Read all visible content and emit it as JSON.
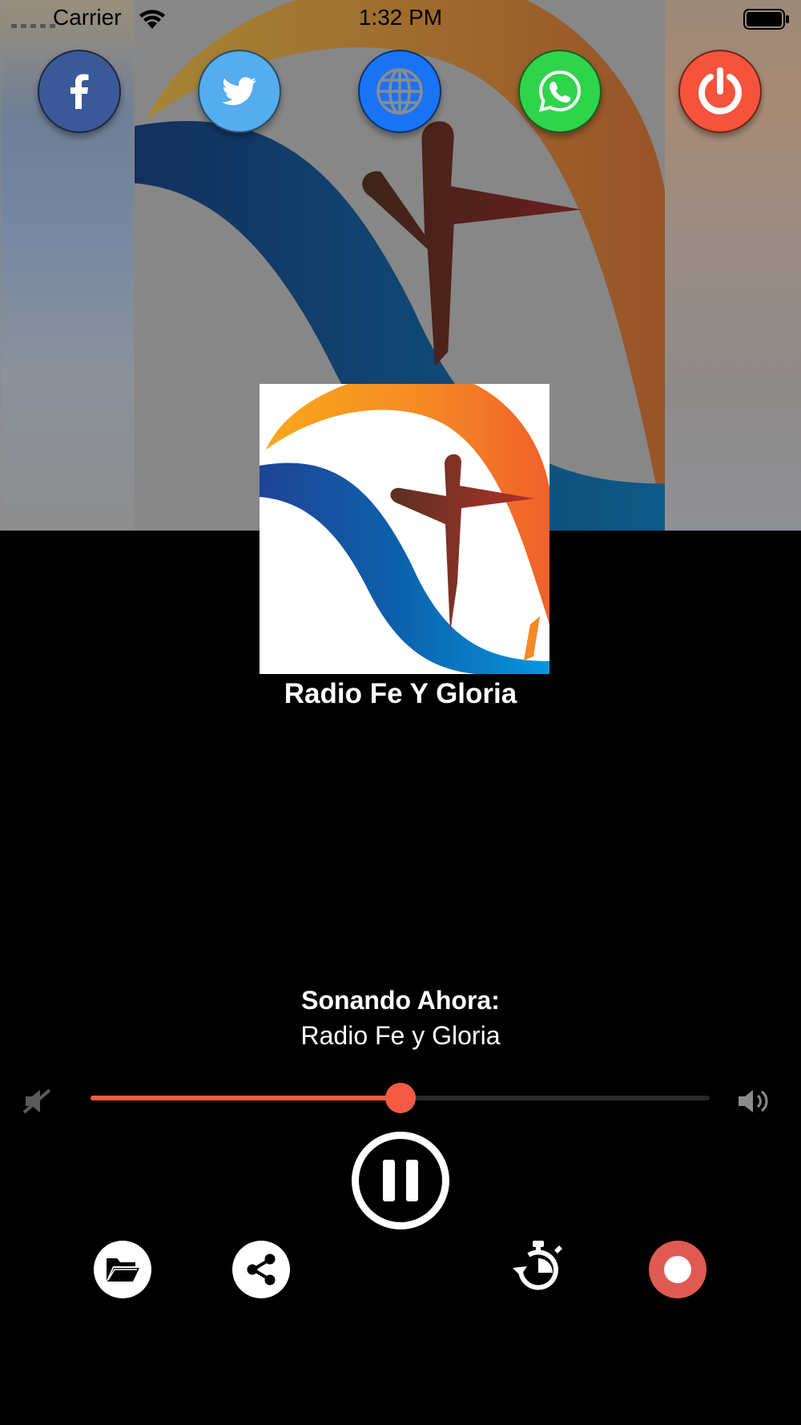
{
  "status_bar": {
    "carrier": "Carrier",
    "time": "1:32 PM",
    "battery_icon": "battery-full-icon",
    "wifi_icon": "wifi-icon"
  },
  "social_buttons": [
    {
      "name": "facebook",
      "icon": "facebook-icon",
      "color": "#3b5998"
    },
    {
      "name": "twitter",
      "icon": "twitter-icon",
      "color": "#55acee"
    },
    {
      "name": "website",
      "icon": "globe-icon",
      "color": "#1a73f5"
    },
    {
      "name": "whatsapp",
      "icon": "whatsapp-icon",
      "color": "#2fd44b"
    },
    {
      "name": "power",
      "icon": "power-icon",
      "color": "#f5533c"
    }
  ],
  "station": {
    "title": "Radio Fe Y Gloria"
  },
  "now_playing": {
    "label": "Sonando Ahora:",
    "title": "Radio Fe y Gloria"
  },
  "volume": {
    "level": 0.5,
    "accent_color": "#f45a43"
  },
  "controls": {
    "play_state": "pause",
    "tools": [
      "folder-icon",
      "share-icon",
      "timer-icon",
      "record-icon"
    ]
  }
}
